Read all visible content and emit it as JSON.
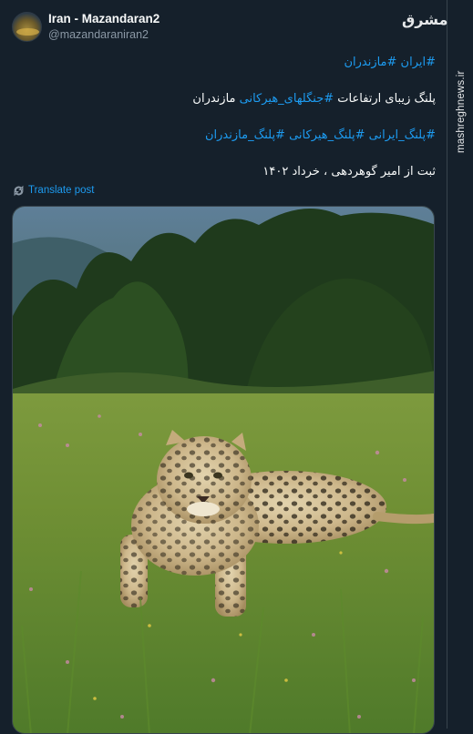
{
  "tweet": {
    "display_name": "Iran - Mazandaran2",
    "handle": "@mazandaraniran2",
    "lines": {
      "line1": {
        "hashtags": "#ایران #مازندران"
      },
      "line2": {
        "prefix": "پلنگ زیبای ارتفاعات ",
        "hashtag": "#جنگلهای_هیرکانی",
        "suffix": " مازندران"
      },
      "line3": {
        "hashtags": "#پلنگ_ایرانی  #پلنگ_هیرکانی #پلنگ_مازندران"
      },
      "line4": {
        "text": "ثبت از امیر گوهردهی ، خرداد ۱۴۰۲"
      }
    },
    "translate_label": "Translate post",
    "photo_subject": "Persian leopard lying in a grassy meadow in front of a forest"
  },
  "watermark": {
    "logo_text": "مشرق",
    "site": "mashreghnews.ir"
  },
  "colors": {
    "background": "#15202b",
    "text": "#f7f9f9",
    "secondary_text": "#8b98a5",
    "link": "#1d9bf0",
    "border": "#38444d"
  }
}
